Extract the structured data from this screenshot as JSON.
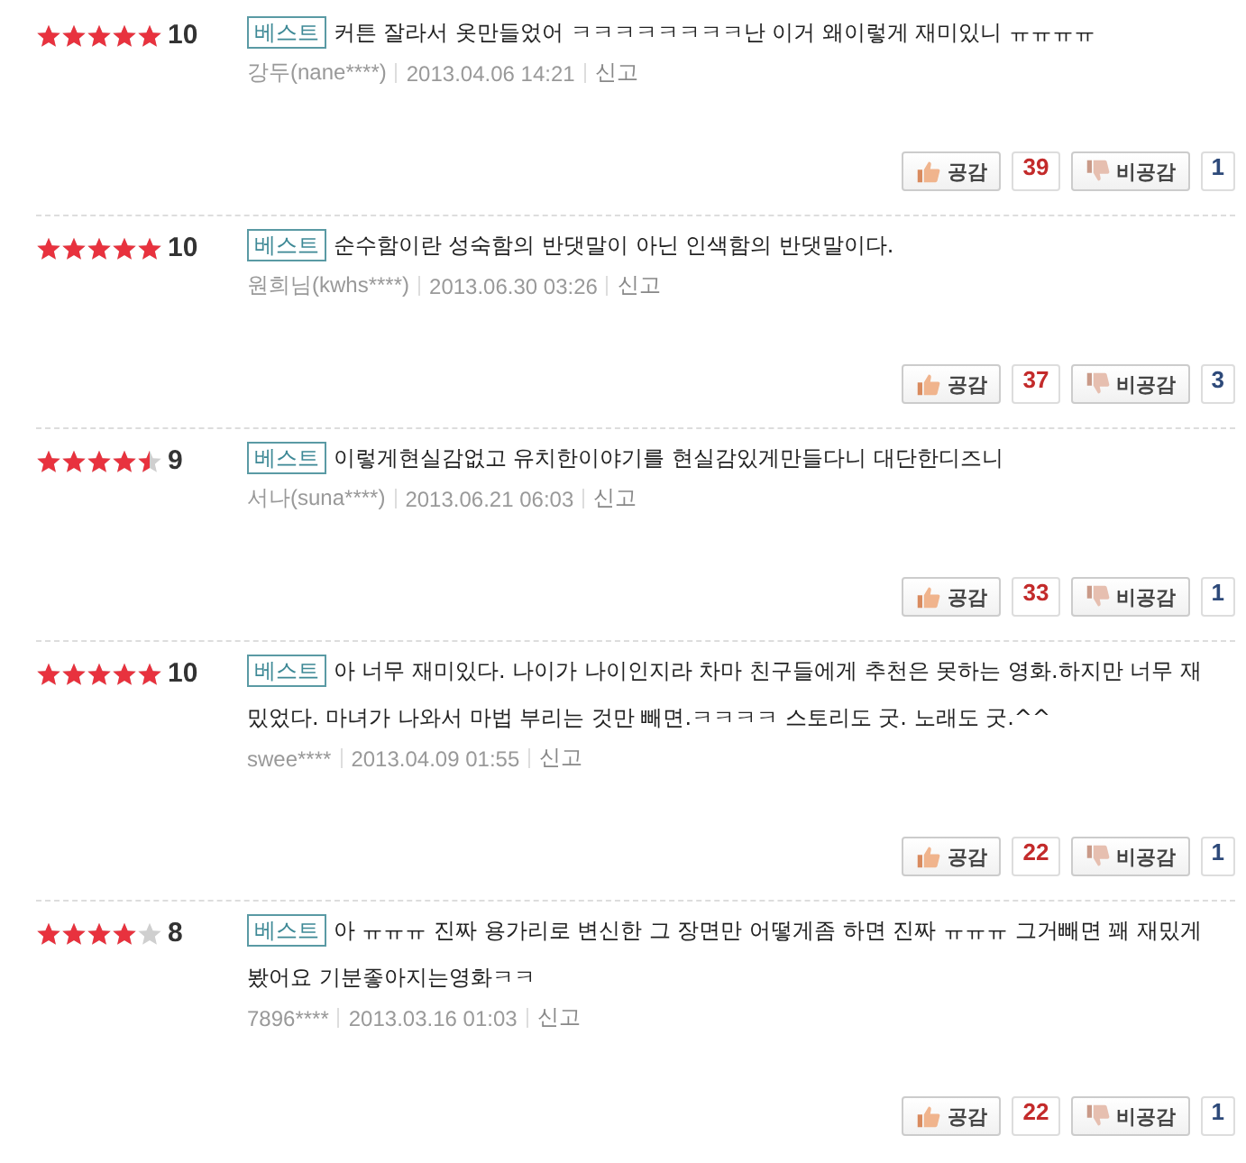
{
  "reviews": [
    {
      "stars": 5,
      "score": "10",
      "badge": "베스트",
      "text": "커튼 잘라서 옷만들었어 ㅋㅋㅋㅋㅋㅋㅋㅋ난 이거 왜이렇게 재미있니 ㅠㅠㅠㅠ",
      "author": "강두(nane****)",
      "date": "2013.04.06 14:21",
      "report": "신고",
      "like_label": "공감",
      "likes": "39",
      "dislike_label": "비공감",
      "dislikes": "1"
    },
    {
      "stars": 5,
      "score": "10",
      "badge": "베스트",
      "text": "순수함이란 성숙함의 반댓말이 아닌 인색함의 반댓말이다.",
      "author": "원희님(kwhs****)",
      "date": "2013.06.30 03:26",
      "report": "신고",
      "like_label": "공감",
      "likes": "37",
      "dislike_label": "비공감",
      "dislikes": "3"
    },
    {
      "stars": 4.5,
      "score": "9",
      "badge": "베스트",
      "text": "이렇게현실감없고 유치한이야기를 현실감있게만들다니 대단한디즈니",
      "author": "서나(suna****)",
      "date": "2013.06.21 06:03",
      "report": "신고",
      "like_label": "공감",
      "likes": "33",
      "dislike_label": "비공감",
      "dislikes": "1"
    },
    {
      "stars": 5,
      "score": "10",
      "badge": "베스트",
      "text": "아 너무 재미있다. 나이가 나이인지라 차마 친구들에게 추천은 못하는 영화.하지만 너무 재밌었다. 마녀가 나와서 마법 부리는 것만 빼면.ㅋㅋㅋㅋ 스토리도 굿. 노래도 굿.^^",
      "author": "swee****",
      "date": "2013.04.09 01:55",
      "report": "신고",
      "like_label": "공감",
      "likes": "22",
      "dislike_label": "비공감",
      "dislikes": "1"
    },
    {
      "stars": 4,
      "score": "8",
      "badge": "베스트",
      "text": "아 ㅠㅠㅠ 진짜 용가리로 변신한 그 장면만 어떻게좀 하면 진짜 ㅠㅠㅠ 그거빼면 꽤 재밌게 봤어요 기분좋아지는영화ㅋㅋ",
      "author": "7896****",
      "date": "2013.03.16 01:03",
      "report": "신고",
      "like_label": "공감",
      "likes": "22",
      "dislike_label": "비공감",
      "dislikes": "1"
    }
  ]
}
